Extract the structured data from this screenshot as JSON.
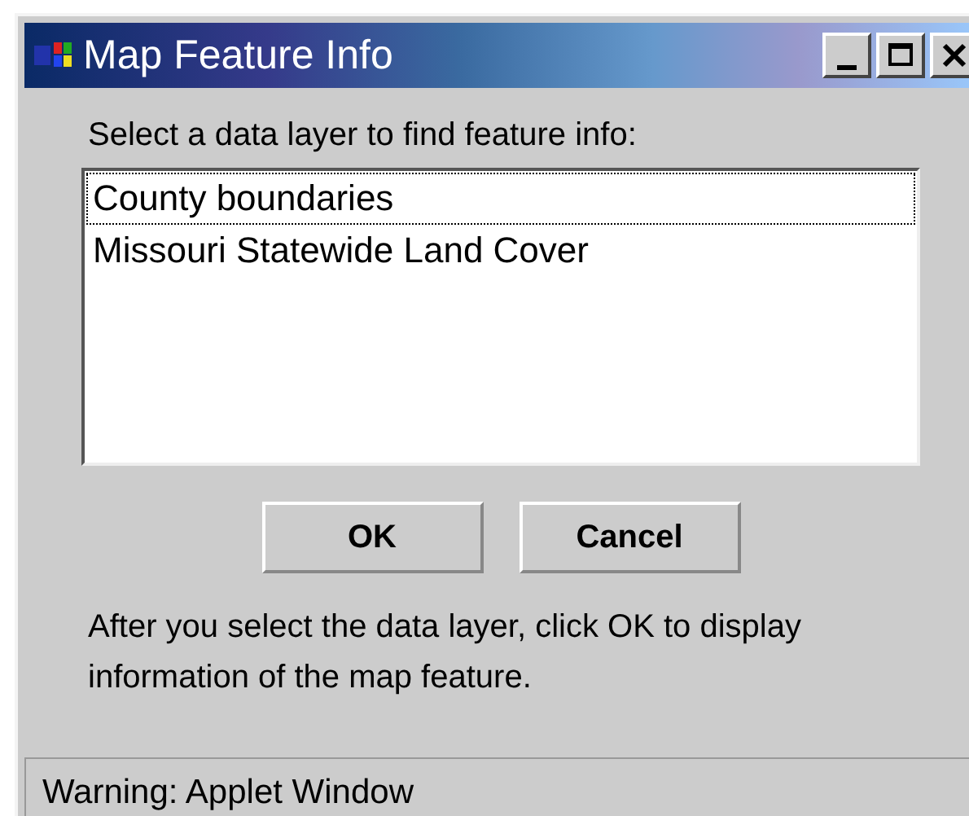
{
  "window": {
    "title": "Map Feature Info",
    "controls": [
      {
        "kind": "minimize"
      },
      {
        "kind": "maximize"
      },
      {
        "kind": "close"
      }
    ]
  },
  "prompt": "Select a data layer to find feature info:",
  "layers": [
    {
      "label": "County boundaries",
      "selected": false,
      "focused": true
    },
    {
      "label": "Missouri Statewide Land Cover",
      "selected": false,
      "focused": false
    }
  ],
  "buttons": [
    "OK",
    "Cancel"
  ],
  "instructions": "After you select the data layer, click OK to display information of the map feature.",
  "status_bar": "Warning: Applet Window"
}
